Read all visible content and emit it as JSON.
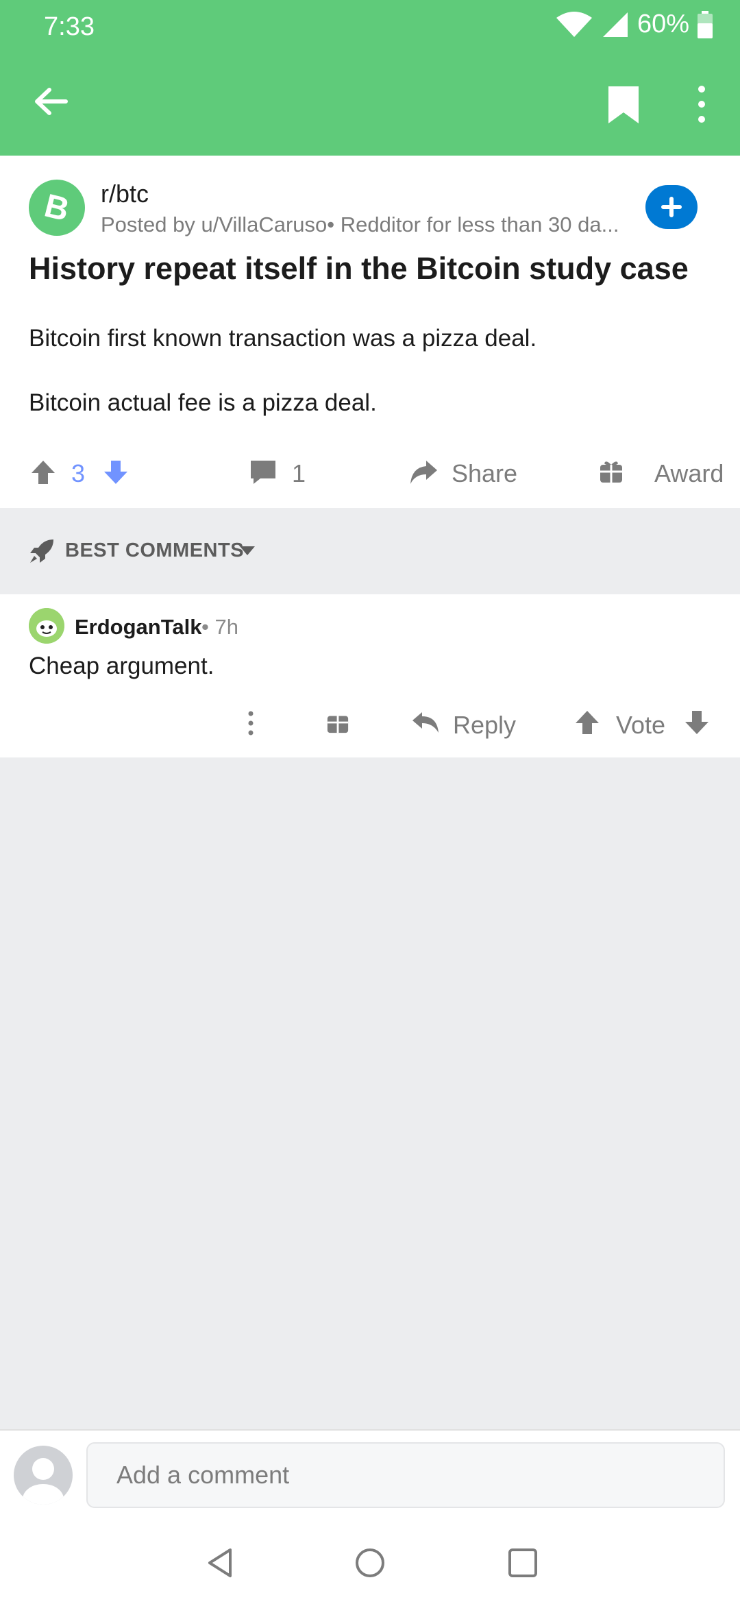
{
  "status_bar": {
    "time": "7:33",
    "battery": "60%"
  },
  "app_bar": {
    "back_icon": "arrow-left-icon",
    "bookmark_icon": "bookmark-icon",
    "more_icon": "more-vertical-icon"
  },
  "post": {
    "subreddit": "r/btc",
    "posted_by": "Posted by u/VillaCaruso• Redditor for less than 30 da...",
    "title": "History repeat itself in the Bitcoin study case",
    "body": [
      "Bitcoin first known transaction was a pizza deal.",
      "Bitcoin actual fee is a pizza deal."
    ],
    "score": "3",
    "comments": "1",
    "share_label": "Share",
    "award_label": "Award"
  },
  "sort": {
    "label": "BEST COMMENTS"
  },
  "comment": {
    "author": "ErdoganTalk",
    "time": "• 7h",
    "body": "Cheap argument.",
    "reply_label": "Reply",
    "vote_label": "Vote"
  },
  "composer": {
    "placeholder": "Add a comment"
  },
  "colors": {
    "header": "#5fcb7a",
    "upvote_active": "#7193ff",
    "join": "#0079d3"
  }
}
